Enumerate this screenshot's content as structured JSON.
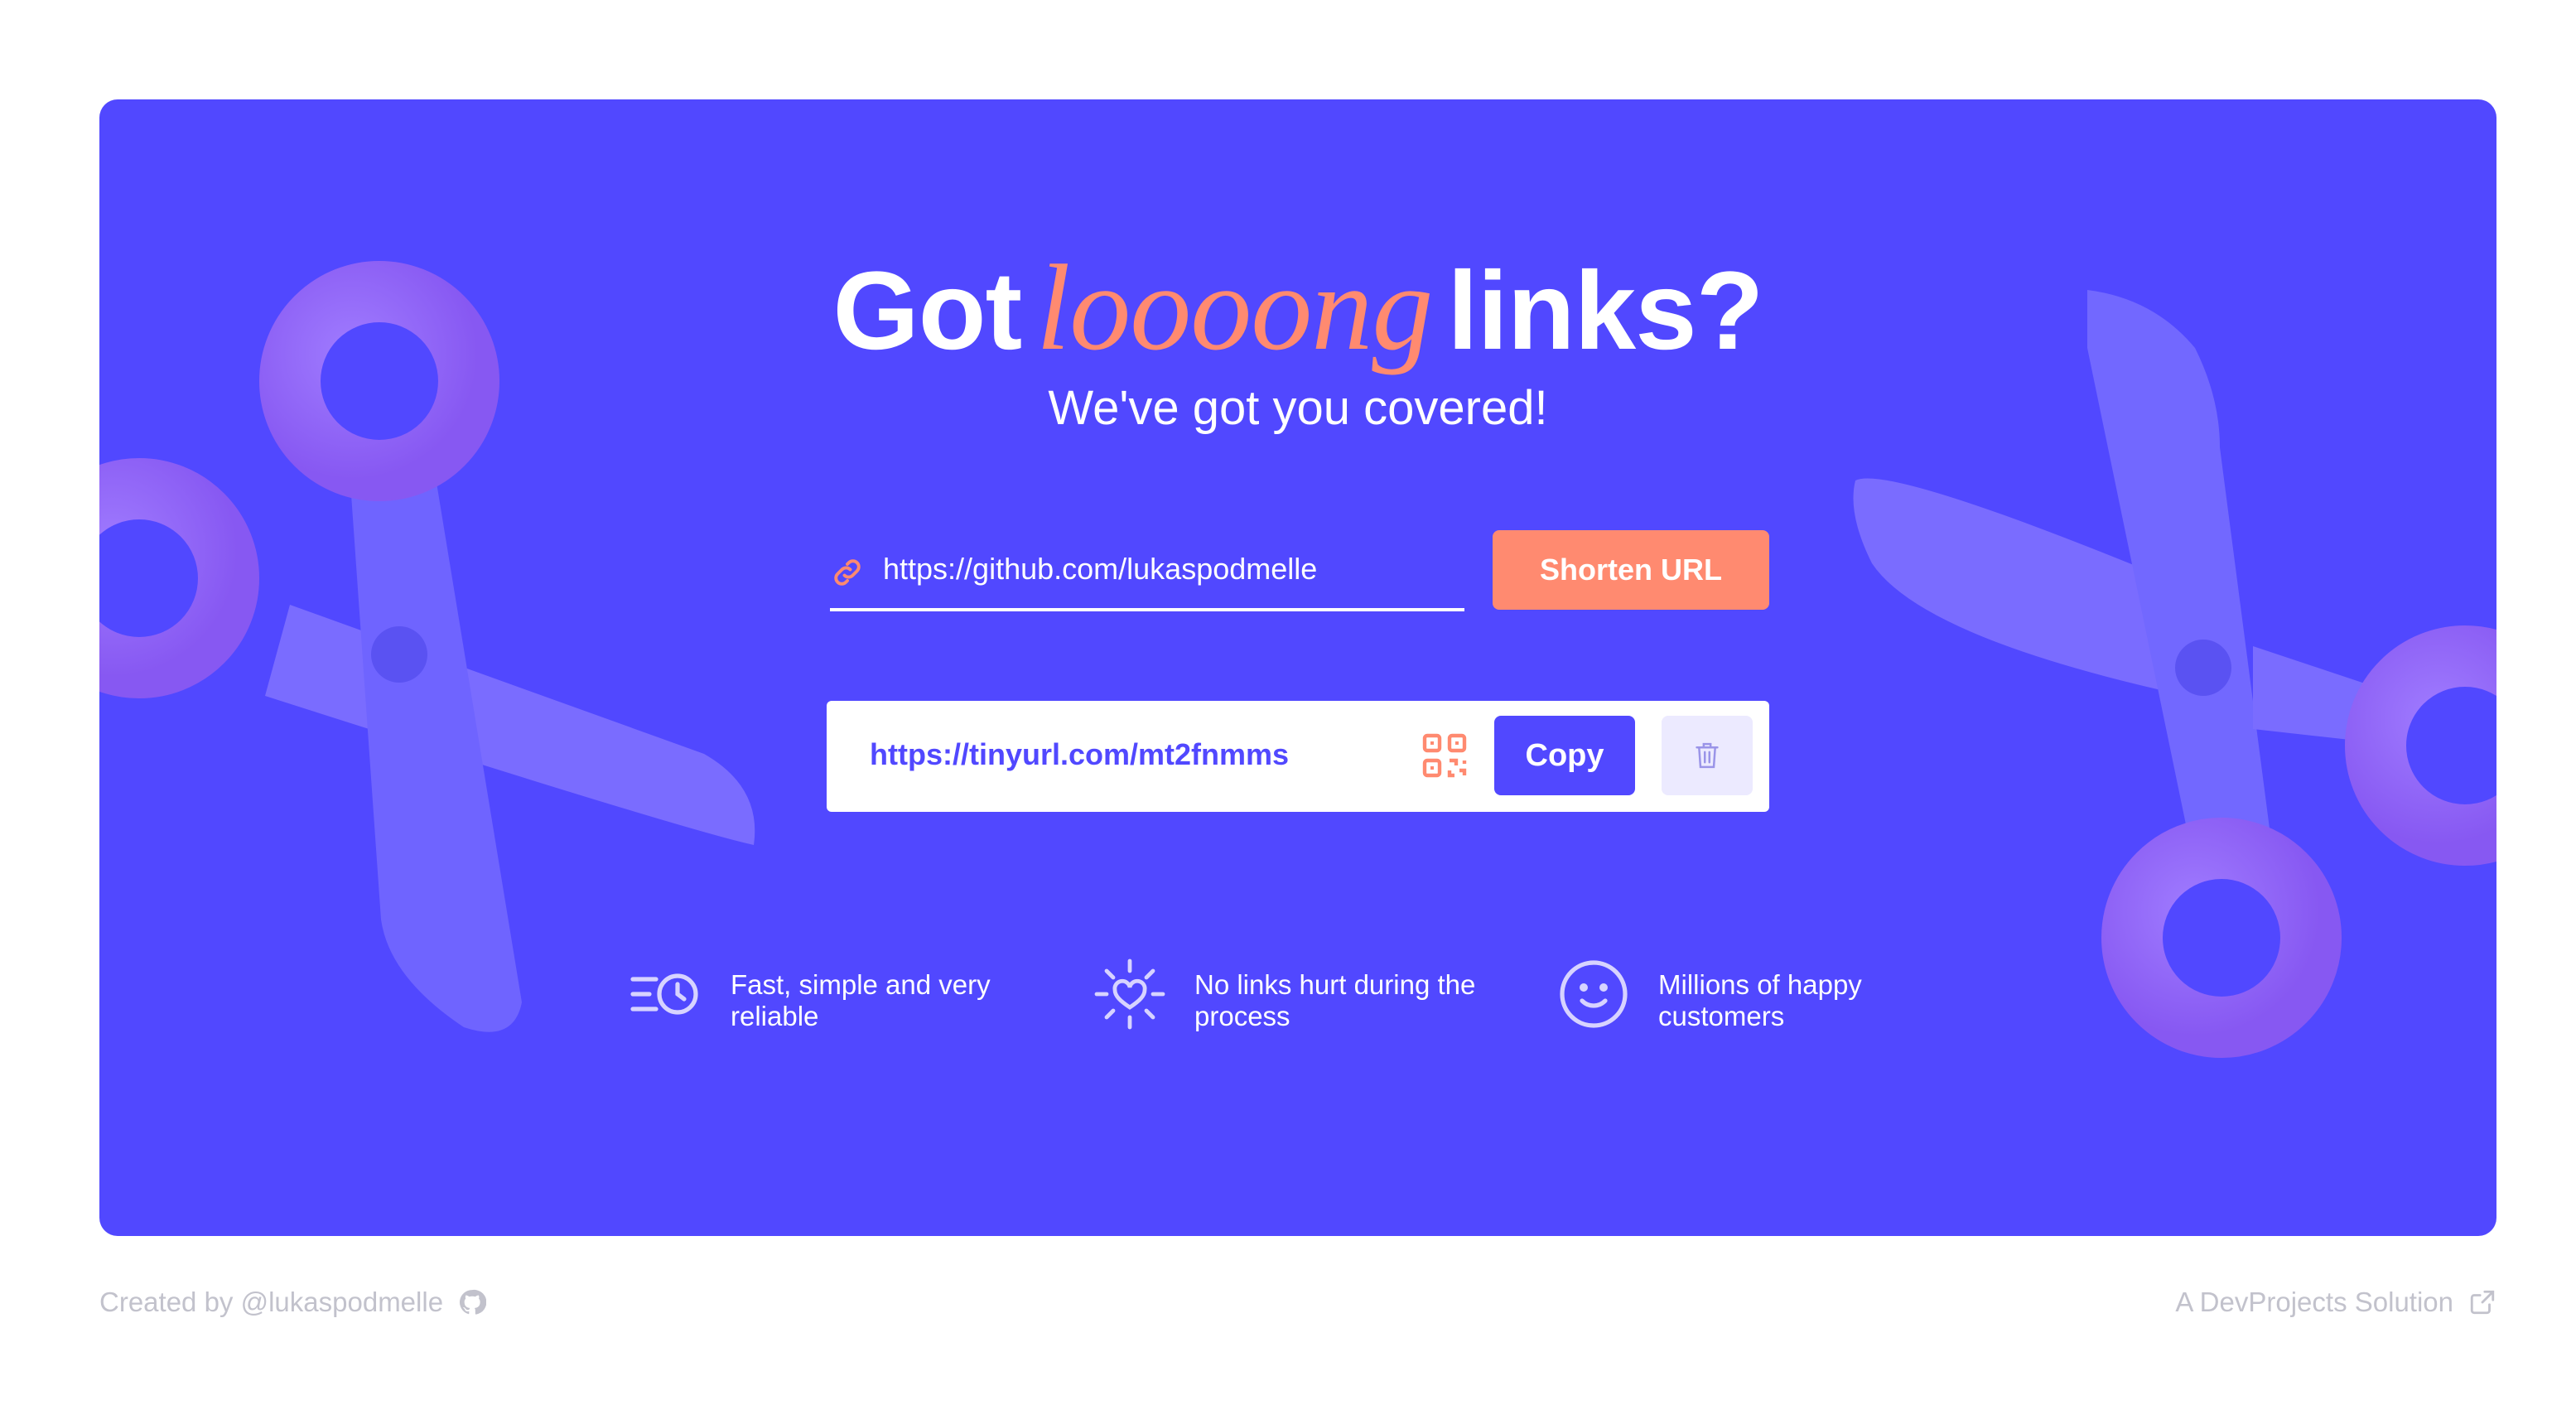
{
  "hero": {
    "title_prefix": "Got",
    "title_emphasis": "loooong",
    "title_suffix": "links?",
    "subtitle": "We've got you covered!"
  },
  "shortener": {
    "input_value": "https://github.com/lukaspodmelle",
    "link_icon": "link-icon",
    "submit_label": "Shorten URL"
  },
  "result": {
    "short_url": "https://tinyurl.com/mt2fnmms",
    "qr_icon": "qr-code-icon",
    "copy_label": "Copy",
    "delete_icon": "trash-icon"
  },
  "features": [
    {
      "icon": "fast-clock-icon",
      "text": "Fast, simple and very reliable"
    },
    {
      "icon": "heart-sparkle-icon",
      "text": "No links hurt during the process"
    },
    {
      "icon": "smiley-icon",
      "text": "Millions of happy customers"
    }
  ],
  "footer": {
    "credit": "Created by @lukaspodmelle",
    "credit_icon": "github-icon",
    "solution": "A DevProjects Solution",
    "solution_icon": "external-link-icon"
  },
  "colors": {
    "primary": "#5148FF",
    "accent": "#FF8A70",
    "white": "#FFFFFF",
    "muted": "#C2C2CC"
  }
}
